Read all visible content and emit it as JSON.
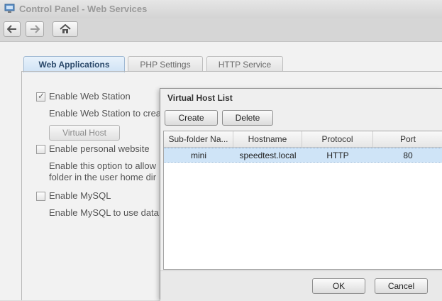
{
  "window": {
    "title": "Control Panel - Web Services"
  },
  "toolbar": {
    "back_icon": "arrow-left-icon",
    "forward_icon": "arrow-right-icon",
    "home_icon": "home-icon"
  },
  "tabs": [
    {
      "label": "Web Applications",
      "active": true
    },
    {
      "label": "PHP Settings",
      "active": false
    },
    {
      "label": "HTTP Service",
      "active": false
    }
  ],
  "options": {
    "web_station": {
      "label": "Enable Web Station",
      "checked": true,
      "desc": "Enable Web Station to crea"
    },
    "virtual_host_button": "Virtual Host",
    "personal_website": {
      "label": "Enable personal website",
      "checked": false,
      "desc1": "Enable this option to allow",
      "desc2": "folder in the user home dir"
    },
    "mysql": {
      "label": "Enable MySQL",
      "checked": false,
      "desc": "Enable MySQL to use data"
    }
  },
  "dialog": {
    "title": "Virtual Host List",
    "create_label": "Create",
    "delete_label": "Delete",
    "columns": [
      "Sub-folder Na...",
      "Hostname",
      "Protocol",
      "Port"
    ],
    "rows": [
      {
        "subfolder": "mini",
        "hostname": "speedtest.local",
        "protocol": "HTTP",
        "port": "80",
        "selected": true
      }
    ],
    "ok_label": "OK",
    "cancel_label": "Cancel"
  },
  "colors": {
    "active_tab": "#cfe2f5",
    "selected_row": "#cfe4f7"
  }
}
